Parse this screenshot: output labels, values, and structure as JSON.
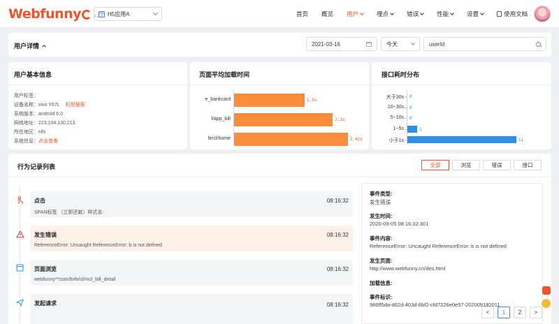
{
  "brand": {
    "name": "Webfunny",
    "version": "2.2.8"
  },
  "app_select": {
    "value": "H5应用A",
    "icon_text": "H5"
  },
  "nav": {
    "items": [
      {
        "label": "首页",
        "dropdown": false
      },
      {
        "label": "概览",
        "dropdown": false
      },
      {
        "label": "用户",
        "dropdown": true,
        "active": true
      },
      {
        "label": "埋点",
        "dropdown": true
      },
      {
        "label": "错误",
        "dropdown": true
      },
      {
        "label": "性能",
        "dropdown": true
      },
      {
        "label": "设置",
        "dropdown": true
      }
    ],
    "docs_label": "使用文档",
    "accent": "#f0522b"
  },
  "header": {
    "title": "用户详情",
    "date": "2021-03-16",
    "period": "今天",
    "search_value": "userId"
  },
  "user_info": {
    "title": "用户基本信息",
    "rows": [
      {
        "label": "用户标签：",
        "value": ""
      },
      {
        "label": "设备名称：",
        "value": "vivo Y67L",
        "link": "机型搜索"
      },
      {
        "label": "系统版本：",
        "value": "android 6.0"
      },
      {
        "label": "网络地址：",
        "value": "223.104.130.213"
      },
      {
        "label": "所在地区：",
        "value": "HN"
      },
      {
        "label": "系统信息：",
        "value": "",
        "link": "点击查看"
      }
    ]
  },
  "load_chart": {
    "title": "页面平均加载时间",
    "chart_data": {
      "type": "bar",
      "orientation": "horizontal",
      "categories": [
        "e_bankcard",
        "l/app_bill",
        "fe/cl/home"
      ],
      "values": [
        1.5,
        2.1,
        2.42
      ],
      "value_labels": [
        "1.5s",
        "2.1s",
        "2.42s"
      ],
      "color": "#fa8c3b"
    }
  },
  "api_chart": {
    "title": "接口耗时分布",
    "chart_data": {
      "type": "bar",
      "orientation": "horizontal",
      "categories": [
        "大于30s",
        "10~30s",
        "5~10s",
        "1~5s",
        "小于1s"
      ],
      "values": [
        0,
        0,
        0,
        1,
        11
      ],
      "color": "#2f8fe8"
    }
  },
  "behavior": {
    "title": "行为记录列表",
    "filters": [
      {
        "label": "全部",
        "active": true
      },
      {
        "label": "浏览"
      },
      {
        "label": "错误"
      },
      {
        "label": "接口"
      }
    ],
    "events": [
      {
        "type": "click",
        "title": "点击",
        "time": "08:16:32",
        "desc": "SPAN标签 （立即还款）样式名:"
      },
      {
        "type": "error",
        "title": "发生错误",
        "time": "08:16:32",
        "desc": "ReferenceError: Uncaught ReferenceError: b is not defined"
      },
      {
        "type": "page",
        "title": "页面浏览",
        "time": "08:16:32",
        "desc": "webfunny**com/ltvfe/cl/mcl_bill_detail"
      },
      {
        "type": "request",
        "title": "发起请求",
        "time": "08:16:32",
        "desc": ""
      }
    ]
  },
  "detail": {
    "fields": [
      {
        "label": "事件类型:",
        "value": "发生错误"
      },
      {
        "label": "发生时间:",
        "value": "2020-09-05 08:16:32.301"
      },
      {
        "label": "事件内容:",
        "value": "ReferenceError: Uncaught ReferenceError: b is not defined"
      },
      {
        "label": "发生页面:",
        "value": "http://www.webfunny.cn/des.html"
      },
      {
        "label": "加载信息:",
        "value": ""
      },
      {
        "label": "事件标识:",
        "value": "986ff5da-d62d-403d-8bf2-cfd7226e0e57-202009182011"
      }
    ]
  },
  "pagination": {
    "prev": "<",
    "next": ">",
    "pages": [
      "1",
      "2"
    ],
    "current": "1"
  }
}
